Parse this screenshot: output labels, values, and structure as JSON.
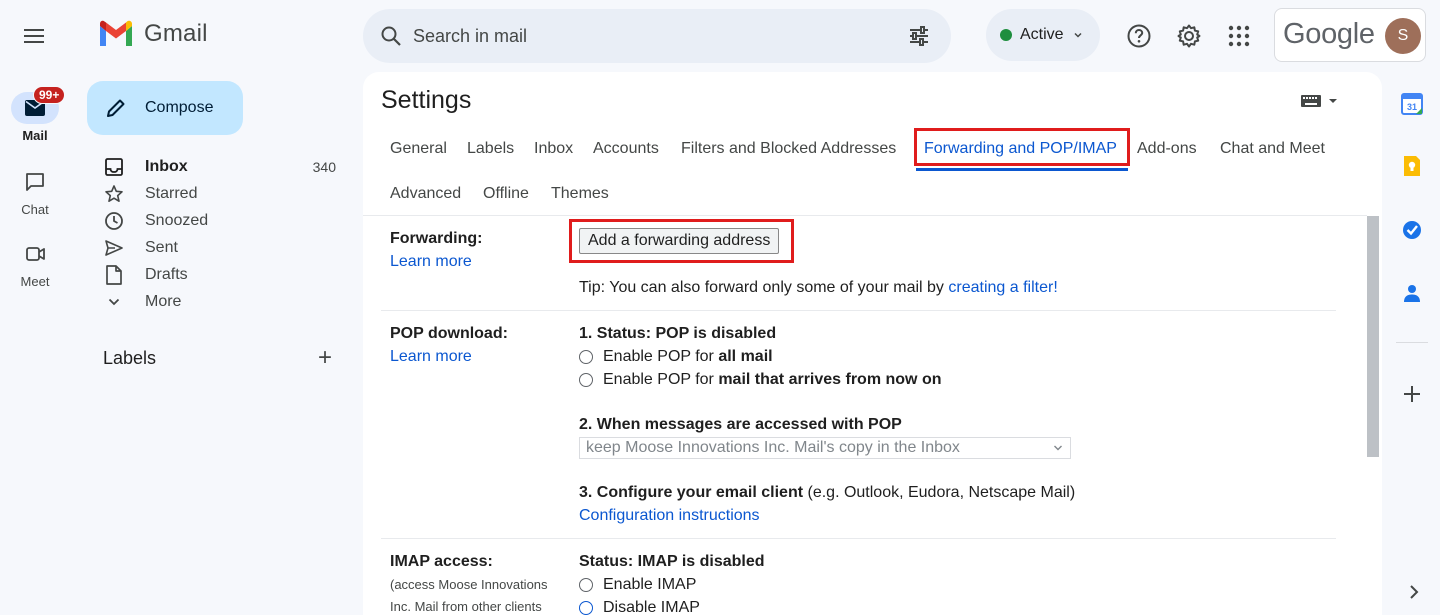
{
  "header": {
    "app_name": "Gmail",
    "search_placeholder": "Search in mail",
    "status_label": "Active",
    "status_color": "#1e8e3e",
    "brand_word": "Google",
    "avatar_initial": "S"
  },
  "rail": {
    "mail_label": "Mail",
    "mail_badge": "99+",
    "chat_label": "Chat",
    "meet_label": "Meet"
  },
  "nav": {
    "compose_label": "Compose",
    "items": [
      {
        "label": "Inbox",
        "count": "340",
        "icon": "inbox-icon"
      },
      {
        "label": "Starred",
        "count": "",
        "icon": "star-icon"
      },
      {
        "label": "Snoozed",
        "count": "",
        "icon": "clock-icon"
      },
      {
        "label": "Sent",
        "count": "",
        "icon": "send-icon"
      },
      {
        "label": "Drafts",
        "count": "",
        "icon": "draft-icon"
      },
      {
        "label": "More",
        "count": "",
        "icon": "chevron-down-icon"
      }
    ],
    "labels_heading": "Labels"
  },
  "settings": {
    "title": "Settings",
    "tabs": [
      {
        "label": "General"
      },
      {
        "label": "Labels"
      },
      {
        "label": "Inbox"
      },
      {
        "label": "Accounts"
      },
      {
        "label": "Filters and Blocked Addresses"
      },
      {
        "label": "Forwarding and POP/IMAP",
        "active": true
      },
      {
        "label": "Add-ons"
      },
      {
        "label": "Chat and Meet"
      },
      {
        "label": "Advanced"
      },
      {
        "label": "Offline"
      },
      {
        "label": "Themes"
      }
    ],
    "forwarding": {
      "label": "Forwarding:",
      "learn_more": "Learn more",
      "button": "Add a forwarding address",
      "tip_prefix": "Tip: You can also forward only some of your mail by ",
      "tip_link": "creating a filter!"
    },
    "pop": {
      "label": "POP download:",
      "learn_more": "Learn more",
      "status": "1. Status: POP is disabled",
      "opt1_prefix": "Enable POP for ",
      "opt1_bold": "all mail",
      "opt2_prefix": "Enable POP for ",
      "opt2_bold": "mail that arrives from now on",
      "when_heading": "2. When messages are accessed with POP",
      "when_select": "keep Moose Innovations Inc. Mail's copy in the Inbox",
      "configure_bold": "3. Configure your email client",
      "configure_rest": " (e.g. Outlook, Eudora, Netscape Mail)",
      "config_link": "Configuration instructions"
    },
    "imap": {
      "label": "IMAP access:",
      "sublabel_1": "(access Moose Innovations",
      "sublabel_2": "Inc. Mail from other clients",
      "status": "Status: IMAP is disabled",
      "opt_enable": "Enable IMAP",
      "opt_disable": "Disable IMAP"
    }
  },
  "highlight_color": "#e01c1c",
  "accent_color": "#0b57d0"
}
